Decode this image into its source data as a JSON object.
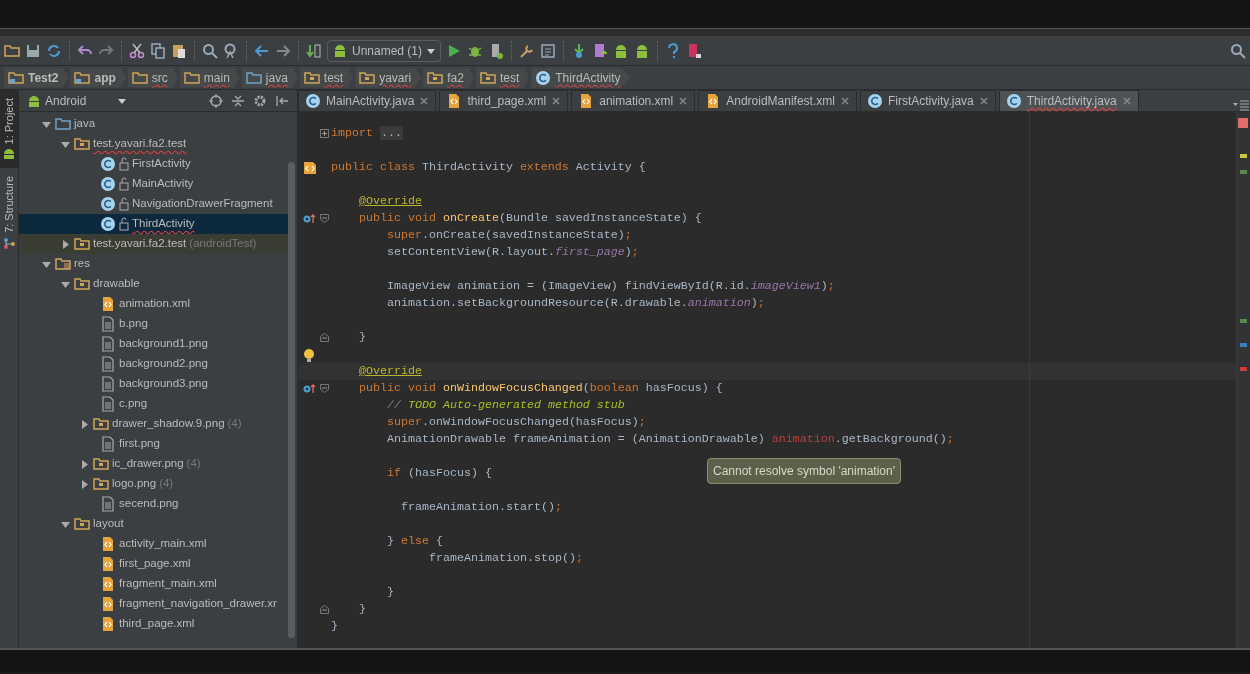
{
  "toolbar": {
    "run_config": "Unnamed (1)"
  },
  "breadcrumbs": [
    {
      "label": "Test2",
      "kind": "module",
      "flagged": false
    },
    {
      "label": "app",
      "kind": "module",
      "flagged": false
    },
    {
      "label": "src",
      "kind": "folder",
      "flagged": true
    },
    {
      "label": "main",
      "kind": "folder",
      "flagged": true
    },
    {
      "label": "java",
      "kind": "source",
      "flagged": true
    },
    {
      "label": "test",
      "kind": "package",
      "flagged": true
    },
    {
      "label": "yavari",
      "kind": "package",
      "flagged": true
    },
    {
      "label": "fa2",
      "kind": "package",
      "flagged": true
    },
    {
      "label": "test",
      "kind": "package",
      "flagged": true
    },
    {
      "label": "ThirdActivity",
      "kind": "class",
      "flagged": true
    }
  ],
  "side_strip": [
    {
      "label": "1: Project",
      "selected": true
    },
    {
      "label": "7: Structure",
      "selected": false
    }
  ],
  "project_pane": {
    "view": "Android",
    "tree": [
      {
        "label": "java",
        "kind": "source",
        "expanded": true,
        "selected": false,
        "flagged": false,
        "children": [
          {
            "label": "test.yavari.fa2.test",
            "kind": "package",
            "expanded": true,
            "selected": false,
            "flagged": true,
            "children": [
              {
                "label": "FirstActivity",
                "kind": "class",
                "selected": false,
                "flagged": false
              },
              {
                "label": "MainActivity",
                "kind": "class",
                "selected": false,
                "flagged": false
              },
              {
                "label": "NavigationDrawerFragment",
                "kind": "class",
                "selected": false,
                "flagged": false
              },
              {
                "label": "ThirdActivity",
                "kind": "class",
                "selected": true,
                "flagged": true
              }
            ]
          },
          {
            "label": "test.yavari.fa2.test",
            "suffix": "(androidTest)",
            "kind": "test-package",
            "expanded": false,
            "selected": false,
            "flagged": false
          }
        ]
      },
      {
        "label": "res",
        "kind": "res",
        "expanded": true,
        "selected": false,
        "flagged": false,
        "children": [
          {
            "label": "drawable",
            "kind": "package",
            "expanded": true,
            "selected": false,
            "flagged": false,
            "children": [
              {
                "label": "animation.xml",
                "kind": "xml",
                "selected": false,
                "flagged": false
              },
              {
                "label": "b.png",
                "kind": "image",
                "selected": false,
                "flagged": false
              },
              {
                "label": "background1.png",
                "kind": "image",
                "selected": false,
                "flagged": false
              },
              {
                "label": "background2.png",
                "kind": "image",
                "selected": false,
                "flagged": false
              },
              {
                "label": "background3.png",
                "kind": "image",
                "selected": false,
                "flagged": false
              },
              {
                "label": "c.png",
                "kind": "image",
                "selected": false,
                "flagged": false
              },
              {
                "label": "drawer_shadow.9.png",
                "suffix": "(4)",
                "kind": "package",
                "expanded": false,
                "selected": false,
                "flagged": false
              },
              {
                "label": "first.png",
                "kind": "image",
                "selected": false,
                "flagged": false
              },
              {
                "label": "ic_drawer.png",
                "suffix": "(4)",
                "kind": "package",
                "expanded": false,
                "selected": false,
                "flagged": false
              },
              {
                "label": "logo.png",
                "suffix": "(4)",
                "kind": "package",
                "expanded": false,
                "selected": false,
                "flagged": false
              },
              {
                "label": "secend.png",
                "kind": "image",
                "selected": false,
                "flagged": false
              }
            ]
          },
          {
            "label": "layout",
            "kind": "package",
            "expanded": true,
            "selected": false,
            "flagged": false,
            "children": [
              {
                "label": "activity_main.xml",
                "kind": "xml",
                "selected": false,
                "flagged": false
              },
              {
                "label": "first_page.xml",
                "kind": "xml",
                "selected": false,
                "flagged": false
              },
              {
                "label": "fragment_main.xml",
                "kind": "xml",
                "selected": false,
                "flagged": false
              },
              {
                "label": "fragment_navigation_drawer.xr",
                "kind": "xml",
                "selected": false,
                "flagged": false
              },
              {
                "label": "third_page.xml",
                "kind": "xml",
                "selected": false,
                "flagged": false
              }
            ]
          }
        ]
      }
    ]
  },
  "tabs": [
    {
      "label": "MainActivity.java",
      "kind": "class",
      "selected": false,
      "flagged": false
    },
    {
      "label": "third_page.xml",
      "kind": "xml",
      "selected": false,
      "flagged": false
    },
    {
      "label": "animation.xml",
      "kind": "xml",
      "selected": false,
      "flagged": false
    },
    {
      "label": "AndroidManifest.xml",
      "kind": "xml",
      "selected": false,
      "flagged": false
    },
    {
      "label": "FirstActivity.java",
      "kind": "class",
      "selected": false,
      "flagged": false
    },
    {
      "label": "ThirdActivity.java",
      "kind": "class",
      "selected": true,
      "flagged": true
    }
  ],
  "editor": {
    "lines": [
      {
        "kind": "top",
        "fold": {
          "kind": "collapsed"
        },
        "tokens": [
          {
            "kind": "keyword",
            "s": "import"
          },
          {
            "kind": "folded",
            "s": "..."
          }
        ]
      },
      {
        "kind": "blank"
      },
      {
        "kind": "top",
        "gutter": {
          "kind": "layout-link"
        },
        "tokens": [
          {
            "kind": "keyword",
            "s": "public class "
          },
          {
            "kind": "plain",
            "s": "ThirdActivity "
          },
          {
            "kind": "keyword",
            "s": "extends "
          },
          {
            "kind": "plain",
            "s": "Activity {"
          }
        ]
      },
      {
        "kind": "blank"
      },
      {
        "kind": "member",
        "tokens": [
          {
            "kind": "annotation",
            "s": "@Override"
          }
        ]
      },
      {
        "kind": "member",
        "gutter": {
          "kind": "override"
        },
        "fold": {
          "kind": "start"
        },
        "tokens": [
          {
            "kind": "keyword",
            "s": "public void "
          },
          {
            "kind": "method",
            "s": "onCreate"
          },
          {
            "kind": "plain",
            "s": "(Bundle savedInstanceState) {"
          }
        ]
      },
      {
        "kind": "body",
        "tokens": [
          {
            "kind": "keyword",
            "s": "super"
          },
          {
            "kind": "plain",
            "s": ".onCreate(savedInstanceState)"
          },
          {
            "kind": "punct",
            "s": ";"
          }
        ]
      },
      {
        "kind": "body",
        "tokens": [
          {
            "kind": "plain",
            "s": "setContentView(R.layout."
          },
          {
            "kind": "field",
            "s": "first_page"
          },
          {
            "kind": "plain",
            "s": ")"
          },
          {
            "kind": "punct",
            "s": ";"
          }
        ]
      },
      {
        "kind": "blank"
      },
      {
        "kind": "body",
        "tokens": [
          {
            "kind": "plain",
            "s": "ImageView animation = (ImageView) findViewById(R.id."
          },
          {
            "kind": "field",
            "s": "imageView1"
          },
          {
            "kind": "plain",
            "s": ")"
          },
          {
            "kind": "punct",
            "s": ";"
          }
        ]
      },
      {
        "kind": "body",
        "tokens": [
          {
            "kind": "plain",
            "s": "animation.setBackgroundResource(R.drawable."
          },
          {
            "kind": "field",
            "s": "animation"
          },
          {
            "kind": "plain",
            "s": ")"
          },
          {
            "kind": "punct",
            "s": ";"
          }
        ]
      },
      {
        "kind": "blank"
      },
      {
        "kind": "member",
        "fold": {
          "kind": "end"
        },
        "tokens": [
          {
            "kind": "plain",
            "s": "}"
          }
        ]
      },
      {
        "kind": "blank",
        "gutter": {
          "kind": "bulb"
        }
      },
      {
        "kind": "member",
        "band": {
          "kind": "caret-line"
        },
        "tokens": [
          {
            "kind": "annotation",
            "s": "@Override"
          }
        ]
      },
      {
        "kind": "member",
        "gutter": {
          "kind": "override"
        },
        "fold": {
          "kind": "start"
        },
        "tokens": [
          {
            "kind": "keyword",
            "s": "public void "
          },
          {
            "kind": "method",
            "s": "onWindowFocusChanged"
          },
          {
            "kind": "plain",
            "s": "("
          },
          {
            "kind": "keyword",
            "s": "boolean "
          },
          {
            "kind": "plain",
            "s": "hasFocus) {"
          }
        ]
      },
      {
        "kind": "body",
        "tokens": [
          {
            "kind": "comment",
            "s": "// "
          },
          {
            "kind": "todo",
            "s": "TODO Auto-generated method stub"
          }
        ]
      },
      {
        "kind": "body",
        "tokens": [
          {
            "kind": "keyword",
            "s": "super"
          },
          {
            "kind": "plain",
            "s": ".onWindowFocusChanged(hasFocus)"
          },
          {
            "kind": "punct",
            "s": ";"
          }
        ]
      },
      {
        "kind": "body",
        "tokens": [
          {
            "kind": "plain",
            "s": "AnimationDrawable frameAnimation = (AnimationDrawable) "
          },
          {
            "kind": "error",
            "s": "animation"
          },
          {
            "kind": "plain",
            "s": ".getBackground()"
          },
          {
            "kind": "punct",
            "s": ";"
          }
        ]
      },
      {
        "kind": "blank"
      },
      {
        "kind": "body",
        "tokens": [
          {
            "kind": "keyword",
            "s": "if "
          },
          {
            "kind": "plain",
            "s": "(hasFocus) {"
          }
        ]
      },
      {
        "kind": "blank"
      },
      {
        "kind": "block",
        "tokens": [
          {
            "kind": "plain",
            "s": "frameAnimation.start()"
          },
          {
            "kind": "punct",
            "s": ";"
          }
        ]
      },
      {
        "kind": "blank"
      },
      {
        "kind": "body",
        "tokens": [
          {
            "kind": "plain",
            "s": "} "
          },
          {
            "kind": "keyword",
            "s": "else "
          },
          {
            "kind": "plain",
            "s": "{"
          }
        ]
      },
      {
        "kind": "deep",
        "tokens": [
          {
            "kind": "plain",
            "s": "frameAnimation.stop()"
          },
          {
            "kind": "punct",
            "s": ";"
          }
        ]
      },
      {
        "kind": "blank"
      },
      {
        "kind": "body",
        "tokens": [
          {
            "kind": "plain",
            "s": "}"
          }
        ]
      },
      {
        "kind": "member",
        "fold": {
          "kind": "end"
        },
        "tokens": [
          {
            "kind": "plain",
            "s": "}"
          }
        ]
      },
      {
        "kind": "top",
        "tokens": [
          {
            "kind": "plain",
            "s": "}"
          }
        ]
      }
    ],
    "tooltip": "Cannot resolve symbol 'animation'",
    "markers": [
      {
        "color": "#c8c83c"
      },
      {
        "color": "#5a8a50"
      },
      {
        "color": "#5a8a50"
      },
      {
        "color": "#3b7ec0"
      },
      {
        "color": "#c8403c"
      }
    ]
  }
}
